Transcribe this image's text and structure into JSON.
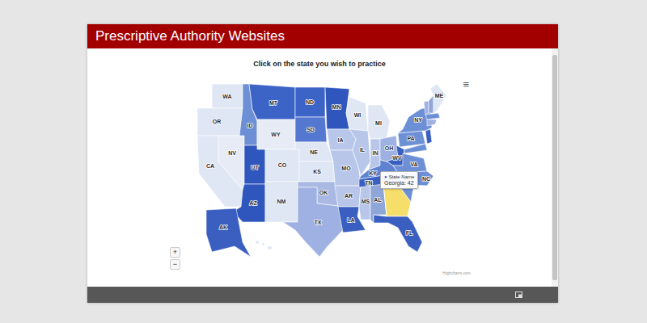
{
  "window": {
    "title": "Prescriptive Authority Websites"
  },
  "map": {
    "subtitle": "Click on the state you wish to practice",
    "menu": "≡",
    "zoom": [
      "+",
      "−"
    ],
    "credit": "Highcharts.com",
    "states": [
      {
        "abbr": "WA",
        "color": "#dfe6f4",
        "selected": false
      },
      {
        "abbr": "OR",
        "color": "#dfe6f4",
        "selected": false
      },
      {
        "abbr": "CA",
        "color": "#dfe6f4",
        "selected": false
      },
      {
        "abbr": "NV",
        "color": "#e6ebf6",
        "selected": false
      },
      {
        "abbr": "ID",
        "color": "#6d8fd6",
        "selected": false
      },
      {
        "abbr": "MT",
        "color": "#3c63c6",
        "selected": false
      },
      {
        "abbr": "WY",
        "color": "#e6ebf6",
        "selected": false
      },
      {
        "abbr": "UT",
        "color": "#2f56bd",
        "selected": false
      },
      {
        "abbr": "AZ",
        "color": "#2f56bd",
        "selected": false
      },
      {
        "abbr": "CO",
        "color": "#dfe6f4",
        "selected": false
      },
      {
        "abbr": "NM",
        "color": "#dfe6f4",
        "selected": false
      },
      {
        "abbr": "ND",
        "color": "#3c63c6",
        "selected": false
      },
      {
        "abbr": "SD",
        "color": "#5477cf",
        "selected": false
      },
      {
        "abbr": "NE",
        "color": "#dfe6f4",
        "selected": false
      },
      {
        "abbr": "KS",
        "color": "#dfe6f4",
        "selected": false
      },
      {
        "abbr": "OK",
        "color": "#aab9e3",
        "selected": false
      },
      {
        "abbr": "TX",
        "color": "#9fb1e2",
        "selected": false
      },
      {
        "abbr": "MN",
        "color": "#2f56bd",
        "selected": false
      },
      {
        "abbr": "IA",
        "color": "#b8c6ea",
        "selected": false
      },
      {
        "abbr": "MO",
        "color": "#b8c6ea",
        "selected": false
      },
      {
        "abbr": "AR",
        "color": "#b8c6ea",
        "selected": false
      },
      {
        "abbr": "LA",
        "color": "#3a5fc0",
        "selected": false
      },
      {
        "abbr": "WI",
        "color": "#dfe6f4",
        "selected": false
      },
      {
        "abbr": "IL",
        "color": "#b8c6ea",
        "selected": false
      },
      {
        "abbr": "MI",
        "color": "#dfe6f4",
        "selected": false
      },
      {
        "abbr": "IN",
        "color": "#b8c6ea",
        "selected": false
      },
      {
        "abbr": "OH",
        "color": "#9fb1e2",
        "selected": false
      },
      {
        "abbr": "WV",
        "color": "#3a5fc0",
        "selected": false
      },
      {
        "abbr": "KY",
        "color": "#5f83d2",
        "selected": false
      },
      {
        "abbr": "VA",
        "color": "#6d8fd6",
        "selected": false
      },
      {
        "abbr": "TN",
        "color": "#3a5fc0",
        "selected": false
      },
      {
        "abbr": "NC",
        "color": "#6d8fd6",
        "selected": false
      },
      {
        "abbr": "MS",
        "color": "#b8c6ea",
        "selected": false
      },
      {
        "abbr": "AL",
        "color": "#8fa6d8",
        "selected": false
      },
      {
        "color": "#f5df6a",
        "selected": true
      },
      {
        "color": "#6d8fd6",
        "selected": false
      },
      {
        "abbr": "FL",
        "color": "#3a5fc0",
        "selected": false
      },
      {
        "abbr": "PA",
        "color": "#6d8fd6",
        "selected": false
      },
      {
        "abbr": "NY",
        "color": "#6d8fd6",
        "selected": false
      },
      {
        "color": "#9fb1e2",
        "selected": false
      },
      {
        "color": "#8fa6d8",
        "selected": false
      },
      {
        "abbr": "ME",
        "color": "#dfe6f4",
        "selected": false
      },
      {
        "color": "#6d8fd6",
        "selected": false
      },
      {
        "color": "#9fb1e2",
        "selected": false
      },
      {
        "color": "#3a5fc0",
        "selected": false
      },
      {
        "color": "#6d8fd6",
        "selected": false
      },
      {
        "abbr": "AK",
        "color": "#3a5fc0",
        "selected": false
      },
      {
        "color": "#dfe6f4",
        "selected": false
      }
    ]
  },
  "tooltip": {
    "marker": "●",
    "label": "State Name",
    "value": "Georgia: 42"
  }
}
